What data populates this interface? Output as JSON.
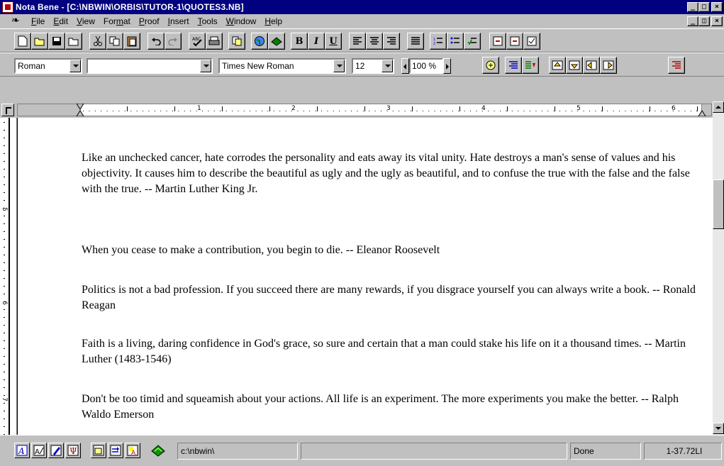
{
  "window": {
    "title": "Nota Bene - [C:\\NBWIN\\ORBIS\\TUTOR-1\\QUOTES3.NB]"
  },
  "menu": {
    "items": [
      {
        "label": "File",
        "key": "F",
        "rest": "ile"
      },
      {
        "label": "Edit",
        "key": "E",
        "rest": "dit"
      },
      {
        "label": "View",
        "key": "V",
        "rest": "iew"
      },
      {
        "label": "Format",
        "pre": "For",
        "key": "m",
        "rest": "at"
      },
      {
        "label": "Proof",
        "key": "P",
        "rest": "roof"
      },
      {
        "label": "Insert",
        "key": "I",
        "rest": "nsert"
      },
      {
        "label": "Tools",
        "key": "T",
        "rest": "ools"
      },
      {
        "label": "Window",
        "key": "W",
        "rest": "indow"
      },
      {
        "label": "Help",
        "key": "H",
        "rest": "elp"
      }
    ]
  },
  "format_bar": {
    "style_value": "Roman",
    "second_value": "",
    "font_value": "Times New Roman",
    "size_value": "12",
    "zoom_value": "100 %"
  },
  "ruler": {
    "numbers": [
      "1",
      "2",
      "3",
      "4",
      "5",
      "6"
    ]
  },
  "vruler": {
    "numbers": [
      "5",
      "6",
      "7"
    ]
  },
  "document": {
    "paragraphs": [
      "Like an unchecked cancer, hate corrodes the personality and eats away its vital unity. Hate destroys a man's sense of values and his objectivity. It causes him to describe the beautiful as ugly and the ugly as beautiful, and to confuse the true with the false and the false with the true. -- Martin Luther King Jr.",
      "When you cease to make a contribution, you begin to die. -- Eleanor Roosevelt",
      "Politics is not a bad profession. If you succeed there are many rewards, if you disgrace yourself you can always write a book. -- Ronald Reagan",
      "Faith is a living, daring confidence in God's grace, so sure and certain that a man could stake his life on it a thousand times.  -- Martin Luther (1483-1546)",
      "Don't be too timid and squeamish about your actions. All life is an experiment. The more experiments you make the better. -- Ralph Waldo Emerson"
    ]
  },
  "status": {
    "path": "c:\\nbwin\\",
    "message": "",
    "state": "Done",
    "position": "1-37.72LI"
  },
  "colors": {
    "titlebar": "#000080",
    "face": "#c0c0c0"
  }
}
